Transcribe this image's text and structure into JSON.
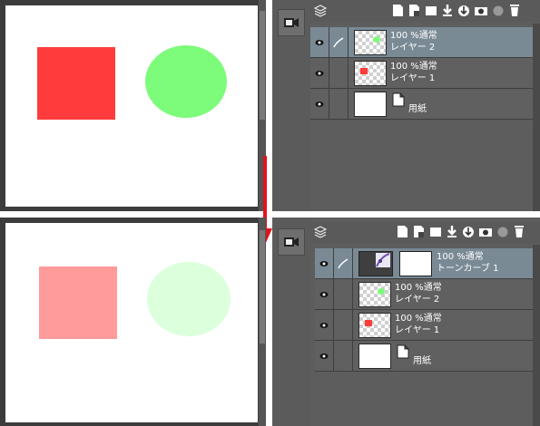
{
  "colors": {
    "red_before": "#ff3b3b",
    "green_before": "#7dfb7a",
    "red_after": "#ff9b9b",
    "green_after": "#dcffdc",
    "selected_row": "#7a8a95",
    "arrow": "#e0141e"
  },
  "icons": {
    "camera": "camera-icon",
    "eye": "eye-icon",
    "brush": "brush-icon",
    "paper": "paper-icon",
    "tone_curve": "tone-curve-icon"
  },
  "top": {
    "layers": [
      {
        "blend": "100 %通常",
        "name": "レイヤー 2",
        "selected": true
      },
      {
        "blend": "100 %通常",
        "name": "レイヤー 1",
        "selected": false
      },
      {
        "name": "用紙",
        "selected": false
      }
    ]
  },
  "bottom": {
    "layers": [
      {
        "blend": "100 %通常",
        "name": "トーンカーブ 1",
        "selected": true
      },
      {
        "blend": "100 %通常",
        "name": "レイヤー 2",
        "selected": false
      },
      {
        "blend": "100 %通常",
        "name": "レイヤー 1",
        "selected": false
      },
      {
        "name": "用紙",
        "selected": false
      }
    ]
  }
}
